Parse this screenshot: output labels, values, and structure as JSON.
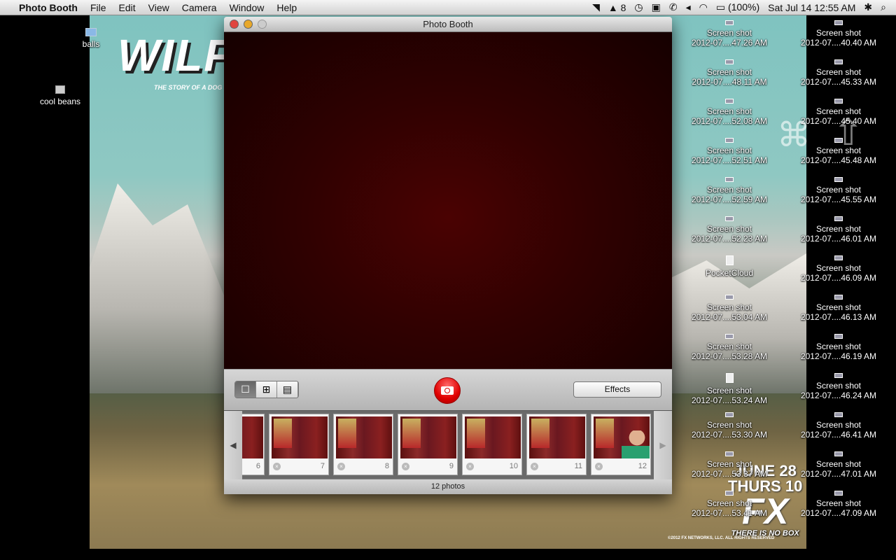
{
  "menubar": {
    "apple_icon": "apple-logo",
    "app": "Photo Booth",
    "items": [
      "File",
      "Edit",
      "View",
      "Camera",
      "Window",
      "Help"
    ],
    "status": {
      "adobe_count": "8",
      "battery": "(100%)",
      "datetime": "Sat Jul 14  12:55 AM"
    }
  },
  "wallpaper": {
    "title": "WILF",
    "tagline": "THE STORY OF A DOG",
    "date": "JUNE 28",
    "day": "THURS 10",
    "logo": "FX",
    "slogan": "THERE IS NO BOX",
    "copyright": "©2012 FX NETWORKS, LLC. ALL RIGHTS RESERVED"
  },
  "desktop_left": [
    {
      "label": "balls",
      "type": "fold"
    },
    {
      "label": "cool beans",
      "type": "disk"
    }
  ],
  "desktop_col1": [
    {
      "l1": "Screen shot",
      "l2": "2012-07....47.26 AM"
    },
    {
      "l1": "Screen shot",
      "l2": "2012-07....48.11 AM"
    },
    {
      "l1": "Screen shot",
      "l2": "2012-07....52.08 AM"
    },
    {
      "l1": "Screen shot",
      "l2": "2012-07....52.51 AM"
    },
    {
      "l1": "Screen shot",
      "l2": "2012-07....52.59 AM"
    },
    {
      "l1": "Screen shot",
      "l2": "2012-07....52.23 AM"
    },
    {
      "l1": "PocketCloud",
      "l2": "",
      "type": "doc"
    },
    {
      "l1": "Screen shot",
      "l2": "2012-07....53.04 AM"
    },
    {
      "l1": "Screen shot",
      "l2": "2012-07....53.28 AM"
    },
    {
      "l1": "Screen shot",
      "l2": "2012-07....53.24 AM",
      "type": "doc"
    },
    {
      "l1": "Screen shot",
      "l2": "2012-07....53.30 AM"
    },
    {
      "l1": "Screen shot",
      "l2": "2012-07....53.37 AM"
    },
    {
      "l1": "Screen shot",
      "l2": "2012-07....53.41 AM"
    }
  ],
  "desktop_col2": [
    {
      "l1": "Screen shot",
      "l2": "2012-07....40.40 AM"
    },
    {
      "l1": "Screen shot",
      "l2": "2012-07....45.33 AM"
    },
    {
      "l1": "Screen shot",
      "l2": "2012-07....45.40 AM"
    },
    {
      "l1": "Screen shot",
      "l2": "2012-07....45.48 AM"
    },
    {
      "l1": "Screen shot",
      "l2": "2012-07....45.55 AM"
    },
    {
      "l1": "Screen shot",
      "l2": "2012-07....46.01 AM"
    },
    {
      "l1": "Screen shot",
      "l2": "2012-07....46.09 AM"
    },
    {
      "l1": "Screen shot",
      "l2": "2012-07....46.13 AM"
    },
    {
      "l1": "Screen shot",
      "l2": "2012-07....46.19 AM"
    },
    {
      "l1": "Screen shot",
      "l2": "2012-07....46.24 AM"
    },
    {
      "l1": "Screen shot",
      "l2": "2012-07....46.41 AM"
    },
    {
      "l1": "Screen shot",
      "l2": "2012-07....47.01 AM"
    },
    {
      "l1": "Screen shot",
      "l2": "2012-07....47.09 AM"
    }
  ],
  "overlay_keys": {
    "command": "⌘",
    "shift": "⇧"
  },
  "window": {
    "title": "Photo Booth",
    "view_modes": [
      {
        "icon": "single-photo-icon",
        "glyph": "☐",
        "active": true
      },
      {
        "icon": "four-up-icon",
        "glyph": "⊞",
        "active": false
      },
      {
        "icon": "movie-icon",
        "glyph": "▤",
        "active": false
      }
    ],
    "effects_label": "Effects",
    "status": "12 photos",
    "thumbnails": [
      {
        "n": "6",
        "partial": true
      },
      {
        "n": "7"
      },
      {
        "n": "8"
      },
      {
        "n": "9"
      },
      {
        "n": "10"
      },
      {
        "n": "11"
      },
      {
        "n": "12",
        "person": true
      }
    ],
    "colors": {
      "shutter": "#e00000",
      "close": "#e0443e",
      "minimize": "#e8a82a"
    }
  }
}
